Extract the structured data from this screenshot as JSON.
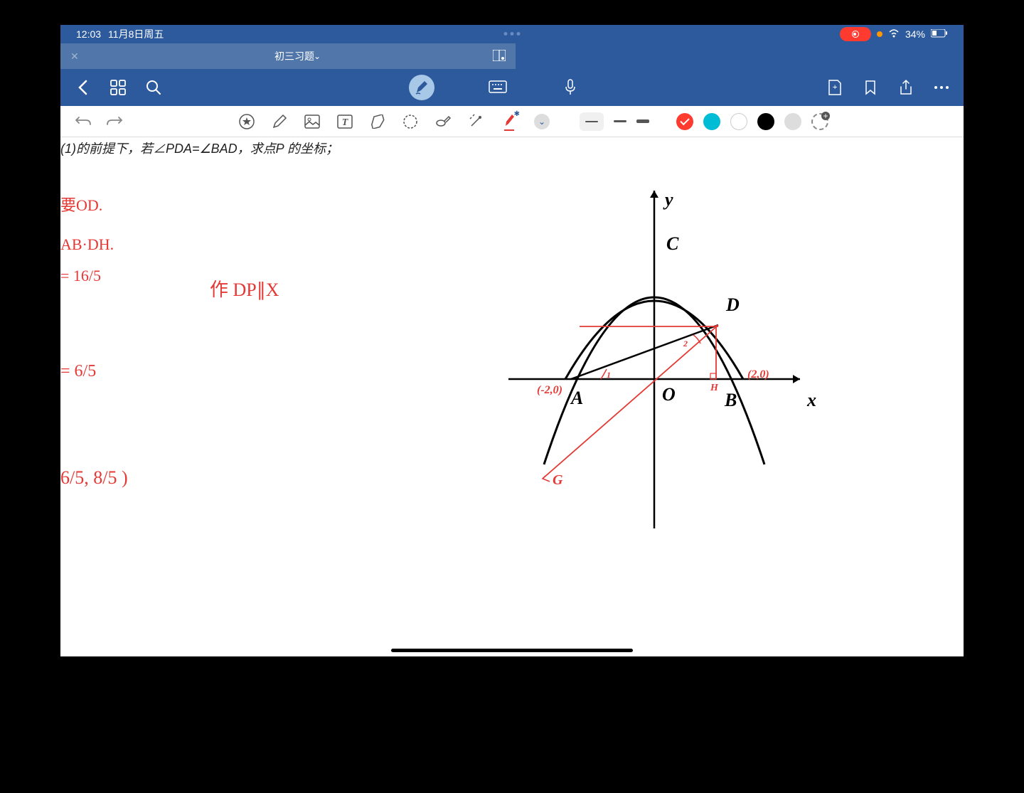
{
  "status": {
    "time": "12:03",
    "date": "11月8日周五",
    "battery": "34%"
  },
  "tab": {
    "title": "初三习题"
  },
  "cutoff": "(1)的前提下，若∠PDA=∠BAD，求点P 的坐标；",
  "notes": {
    "n1": "要OD.",
    "n2": "AB·DH.",
    "n3": "= 16/5",
    "n4": "作 DP∥X",
    "n5": "= 6/5",
    "n6": "6/5, 8/5 )"
  },
  "graph": {
    "labels": {
      "y": "y",
      "x": "x",
      "C": "C",
      "D": "D",
      "A": "A",
      "B": "B",
      "O": "O"
    },
    "annotations": {
      "left": "(-2,0)",
      "right": "(2,0)",
      "H": "H",
      "G": "G",
      "ang1": "1",
      "ang2": "2"
    }
  }
}
